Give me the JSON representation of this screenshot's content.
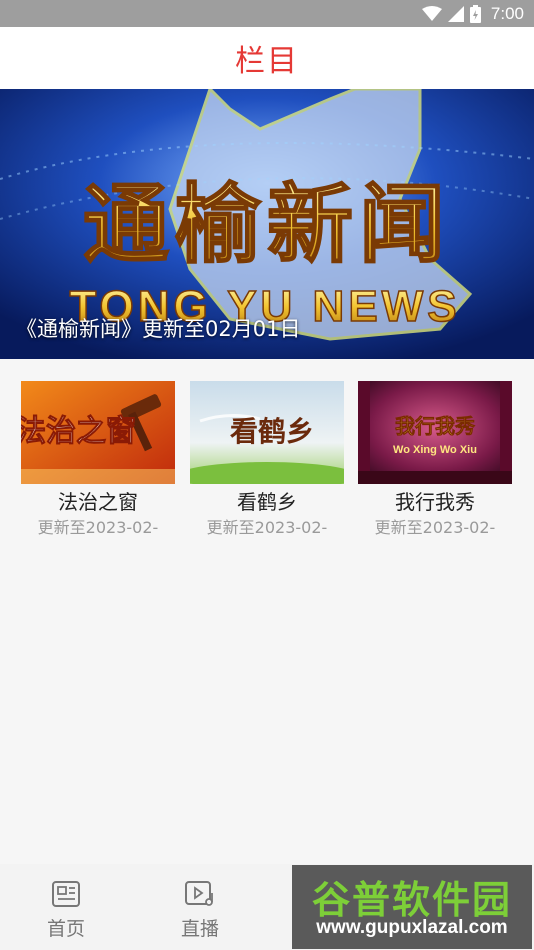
{
  "status_bar": {
    "time": "7:00",
    "icons": [
      "wifi-icon",
      "signal-icon",
      "battery-icon"
    ]
  },
  "header": {
    "title": "栏目",
    "title_color": "#e53935"
  },
  "banner": {
    "logo_text": "通榆新闻",
    "logo_subtext": "TONG YU NEWS",
    "caption": "《通榆新闻》更新至02月01日"
  },
  "programs": [
    {
      "title": "法治之窗",
      "subtitle": "更新至2023-02-",
      "thumb_text": "法治之窗"
    },
    {
      "title": "看鹤乡",
      "subtitle": "更新至2023-02-",
      "thumb_text": "看鹤乡"
    },
    {
      "title": "我行我秀",
      "subtitle": "更新至2023-02-",
      "thumb_text": "我行我秀",
      "thumb_subtext": "Wo Xing Wo Xiu"
    }
  ],
  "bottom_nav": {
    "items": [
      {
        "label": "首页",
        "icon": "news-icon"
      },
      {
        "label": "直播",
        "icon": "live-video-icon"
      }
    ]
  },
  "watermark": {
    "text": "谷普软件园",
    "url": "www.gupuxlazal.com"
  }
}
